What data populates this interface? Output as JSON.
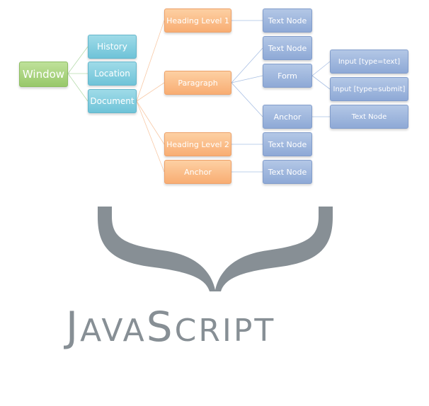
{
  "tree": {
    "window": "Window",
    "history": "History",
    "location": "Location",
    "document": "Document",
    "heading1": "Heading Level 1",
    "paragraph": "Paragraph",
    "heading2": "Heading Level 2",
    "anchor_doc": "Anchor",
    "text_h1": "Text Node",
    "text_para": "Text Node",
    "form": "Form",
    "anchor_para": "Anchor",
    "text_h2": "Text Node",
    "text_anchor": "Text Node",
    "input_text": "Input [type=text]",
    "input_submit": "Input [type=submit]",
    "text_anchor_para": "Text Node"
  },
  "logo": {
    "j": "J",
    "ava": "AVA",
    "s": "S",
    "cript": "CRIPT",
    "color": "#878f95"
  },
  "colors": {
    "green": "#a9d47f",
    "cyan": "#84cee0",
    "orange": "#f9b988",
    "blue": "#9db6de"
  }
}
